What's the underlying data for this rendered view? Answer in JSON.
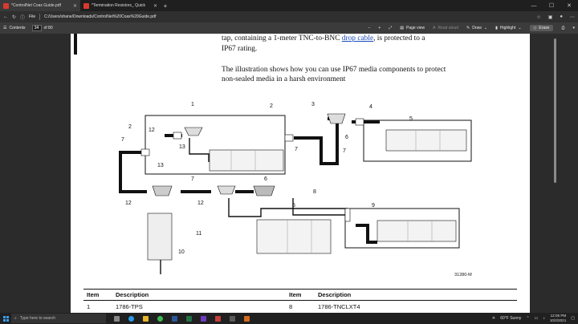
{
  "tabs": [
    {
      "title": "*ControlNet Coax Guide.pdf",
      "active": true
    },
    {
      "title": "*Termination Resistors_ Quick",
      "active": false
    }
  ],
  "window_controls": {
    "minimize": "—",
    "maximize": "☐",
    "close": "✕"
  },
  "address": {
    "file_label": "File",
    "url": "C:/Users/shane/Downloads/ControlNet%20Coax%20Guide.pdf"
  },
  "toolbar": {
    "contents": "Contents",
    "page_current": "34",
    "page_total": "of 80",
    "page_view": "Page view",
    "read_aloud": "Read aloud",
    "draw": "Draw",
    "highlight": "Highlight",
    "erase": "Erase"
  },
  "document": {
    "para1_line1_a": "tap, containing a 1-meter TNC-to-BNC ",
    "para1_link": "drop cable",
    "para1_line1_b": ", is protected to a",
    "para1_line2": "IP67 rating.",
    "para2_line1": "The illustration shows how you can use IP67 media components to protect",
    "para2_line2": "non-sealed media in a harsh environment",
    "callouts": [
      "1",
      "2",
      "3",
      "4",
      "5",
      "6",
      "7",
      "8",
      "9",
      "10",
      "11",
      "12",
      "13"
    ],
    "figure_id": "31280-M",
    "table": {
      "headers": [
        "Item",
        "Description",
        "Item",
        "Description"
      ],
      "row1": [
        "1",
        "1786-TPS",
        "8",
        "1786-TNCLXT4"
      ]
    }
  },
  "taskbar": {
    "search_placeholder": "Type here to search",
    "weather": "60°F  Sunny",
    "time": "12:06 PM",
    "date": "10/2/2021"
  },
  "colors": {
    "accent_pdf": "#d93a2f",
    "link": "#1a4ab8"
  }
}
